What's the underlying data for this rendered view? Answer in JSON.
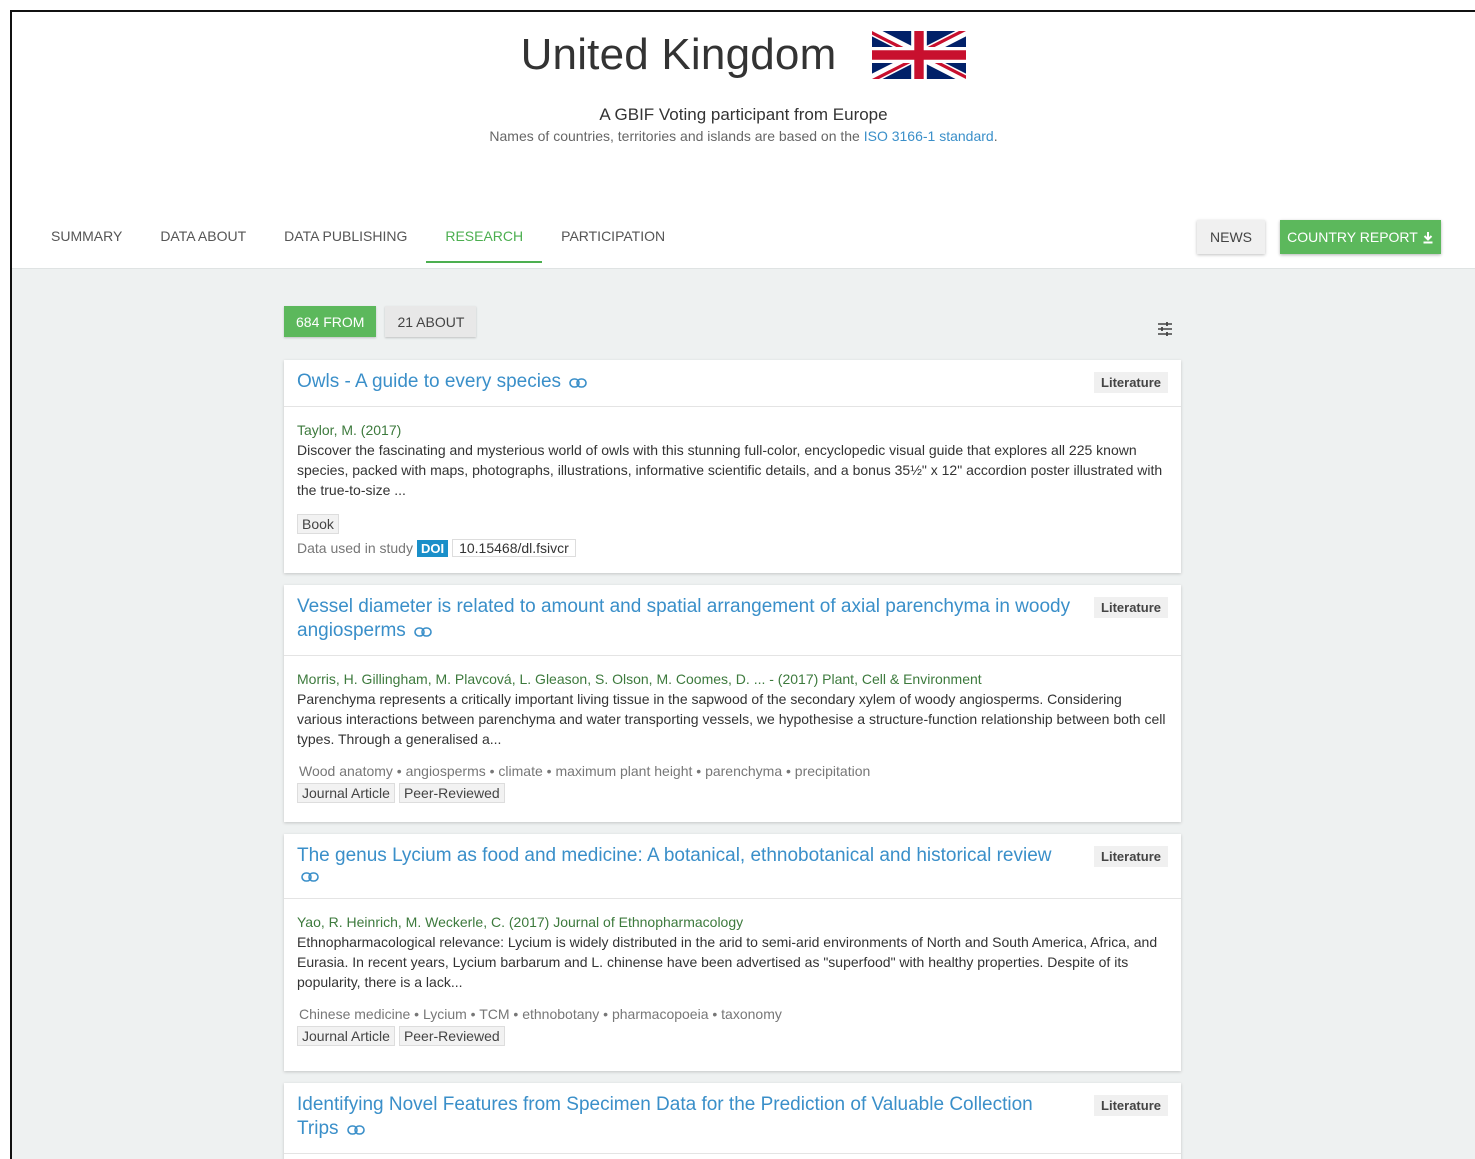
{
  "header": {
    "title": "United Kingdom",
    "subtitle": "A GBIF Voting participant from Europe",
    "note_prefix": "Names of countries, territories and islands are based on the ",
    "note_link": "ISO 3166-1 standard",
    "note_suffix": "."
  },
  "tabs": [
    {
      "label": "SUMMARY"
    },
    {
      "label": "DATA ABOUT"
    },
    {
      "label": "DATA PUBLISHING"
    },
    {
      "label": "RESEARCH"
    },
    {
      "label": "PARTICIPATION"
    }
  ],
  "buttons": {
    "news": "NEWS",
    "country_report": "COUNTRY REPORT"
  },
  "filters": {
    "from_label": "684 FROM",
    "about_label": "21 ABOUT"
  },
  "colors": {
    "accent_green": "#5cb85c",
    "link_blue": "#3a8fc9",
    "doi_blue": "#1a8fc9"
  },
  "results": [
    {
      "title": "Owls - A guide to every species",
      "badge": "Literature",
      "authors": "Taylor, M. (2017)",
      "abstract": "Discover the fascinating and mysterious world of owls with this stunning full-color, encyclopedic visual guide that explores all 225 known species, packed with maps, photographs, illustrations, informative scientific details, and a bonus 35½\" x 12\" accordion poster illustrated with the true-to-size ...",
      "tag": "Book",
      "study_label": "Data used in study",
      "doi_label": "DOI",
      "doi": "10.15468/dl.fsivcr"
    },
    {
      "title": "Vessel diameter is related to amount and spatial arrangement of axial parenchyma in woody angiosperms",
      "badge": "Literature",
      "authors": "Morris, H. Gillingham, M. Plavcová, L. Gleason, S. Olson, M. Coomes, D. ... - (2017) Plant, Cell & Environment",
      "abstract": "Parenchyma represents a critically important living tissue in the sapwood of the secondary xylem of woody angiosperms. Considering various interactions between parenchyma and water transporting vessels, we hypothesise a structure-function relationship between both cell types. Through a generalised a...",
      "keywords": "Wood anatomy • angiosperms • climate • maximum plant height • parenchyma • precipitation",
      "tag1": "Journal Article",
      "tag2": "Peer-Reviewed"
    },
    {
      "title": "The genus Lycium as food and medicine: A botanical, ethnobotanical and historical review",
      "badge": "Literature",
      "authors": "Yao, R. Heinrich, M. Weckerle, C. (2017) Journal of Ethnopharmacology",
      "abstract": "Ethnopharmacological relevance: Lycium is widely distributed in the arid to semi-arid environments of North and South America, Africa, and Eurasia. In recent years, Lycium barbarum and L. chinense have been advertised as \"superfood\" with healthy properties. Despite of its popularity, there is a lack...",
      "keywords": "Chinese medicine • Lycium • TCM • ethnobotany • pharmacopoeia • taxonomy",
      "tag1": "Journal Article",
      "tag2": "Peer-Reviewed"
    },
    {
      "title": "Identifying Novel Features from Specimen Data for the Prediction of Valuable Collection Trips",
      "badge": "Literature"
    }
  ]
}
